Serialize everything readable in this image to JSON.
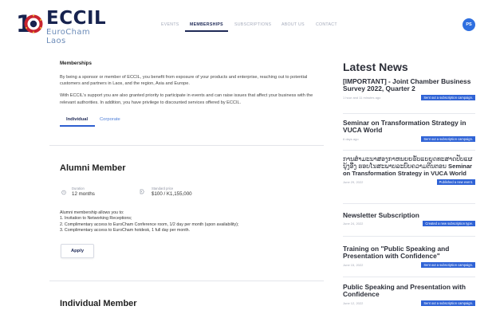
{
  "header": {
    "logo_word": "ECCIL",
    "logo_sub": "EuroCham Laos",
    "nav": [
      {
        "label": "EVENTS",
        "active": false
      },
      {
        "label": "MEMBERSHIPS",
        "active": true
      },
      {
        "label": "SUBSCRIPTIONS",
        "active": false
      },
      {
        "label": "ABOUT US",
        "active": false
      },
      {
        "label": "CONTACT",
        "active": false
      }
    ],
    "avatar_initials": "PS"
  },
  "main": {
    "section_title": "Memberships",
    "intro_1": "By being a sponsor or member of ECCIL, you benefit from exposure of your products and enterprise, reaching out to potential customers and partners in Laos, and the region, Asia and Europe.",
    "intro_2": "With ECCIL's support you are also granted priority to participate in events and can raise issues that affect your business with the relevant authorities. In addition, you have privilege to discounted services offered by ECCIL.",
    "tabs": [
      {
        "label": "Individual",
        "active": true
      },
      {
        "label": "Corporate",
        "active": false
      }
    ],
    "alumni": {
      "title": "Alumni Member",
      "duration_label": "Duration",
      "duration_value": "12 months",
      "price_label": "Standard price",
      "price_value": "$100 / K1,155,000",
      "benefits": [
        "Alumni membership allows you to:",
        "1. Invitation to Networking Receptions;",
        "2. Complimentary access to EuroCham Conference room, 1/2 day per month (upon availability);",
        "3. Complimentary access to EuroCham hotdesk, 1 full day per month."
      ],
      "apply_label": "Apply"
    },
    "individual_title": "Individual Member"
  },
  "sidebar": {
    "heading": "Latest News",
    "items": [
      {
        "title": "[IMPORTANT] - Joint Chamber Business Survey 2022, Quarter 2",
        "date": "1 hour and 11 minutes ago",
        "badge": "Sent out a subscription campaign."
      },
      {
        "title": "Seminar on Transformation Strategy in VUCA World",
        "date": "6 days ago",
        "badge": "Sent out a subscription campaign."
      },
      {
        "title_lao": "ການສຳມະນາສອງກາຫນຍຍຮັບແຍຍຸດທະສາດປັບແຜນຸ້ງອື່ງ ຮອບໂນສະພາບລະບົບຄວາມຕີນຕອນ",
        "title_en": "Seminar on Transformation Strategy in VUCA World",
        "date": "June 29, 2022",
        "badge": "Published a new event."
      },
      {
        "title": "Newsletter Subscription",
        "date": "June 24, 2022",
        "badge": "Created a new subscription type."
      },
      {
        "title": "Training on \"Public Speaking and Presentation with Confidence\"",
        "date": "June 15, 2022",
        "badge": "Sent out a subscription campaign."
      },
      {
        "title": "Public Speaking and Presentation with Confidence",
        "date": "June 12, 2022",
        "badge": "Sent out a subscription campaign."
      }
    ]
  },
  "colors": {
    "brand_navy": "#17234f",
    "accent_blue": "#2f63d6",
    "logo_red": "#c8242f",
    "avatar_blue": "#2e6fe0"
  }
}
